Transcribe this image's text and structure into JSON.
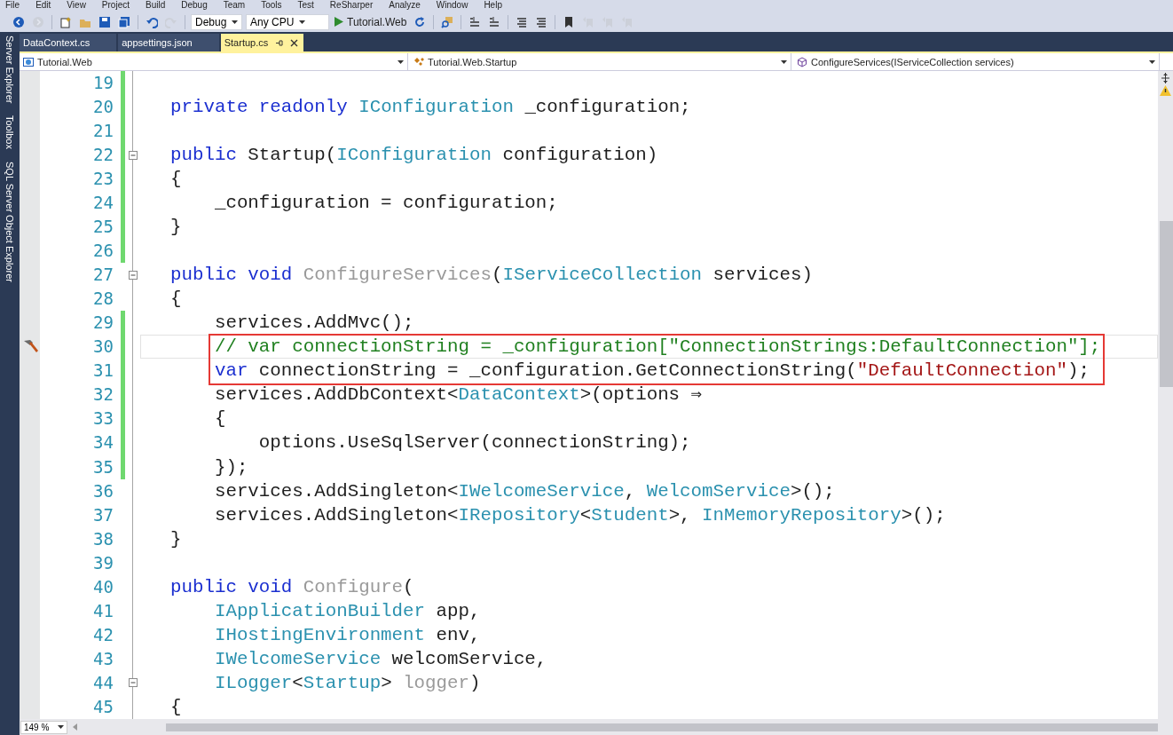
{
  "menu": [
    "File",
    "Edit",
    "View",
    "Project",
    "Build",
    "Debug",
    "Team",
    "Tools",
    "Test",
    "ReSharper",
    "Analyze",
    "Window",
    "Help"
  ],
  "toolbar": [
    {
      "kind": "back",
      "disabled": false
    },
    {
      "kind": "forward",
      "disabled": true
    },
    {
      "kind": "sep"
    },
    {
      "kind": "new-project",
      "disabled": false
    },
    {
      "kind": "open",
      "disabled": false
    },
    {
      "kind": "save",
      "disabled": false
    },
    {
      "kind": "save-all",
      "disabled": false
    },
    {
      "kind": "sep"
    },
    {
      "kind": "undo",
      "disabled": false
    },
    {
      "kind": "redo",
      "disabled": true
    },
    {
      "kind": "sep"
    },
    {
      "kind": "combo",
      "value": "Debug"
    },
    {
      "kind": "combo",
      "value": "Any CPU"
    },
    {
      "kind": "start",
      "label": "Tutorial.Web"
    },
    {
      "kind": "refresh",
      "disabled": false
    },
    {
      "kind": "sep"
    },
    {
      "kind": "find",
      "disabled": false
    },
    {
      "kind": "sep"
    },
    {
      "kind": "step",
      "disabled": false
    },
    {
      "kind": "step",
      "disabled": false
    },
    {
      "kind": "sep"
    },
    {
      "kind": "comment",
      "disabled": false
    },
    {
      "kind": "comment",
      "disabled": false
    },
    {
      "kind": "sep"
    },
    {
      "kind": "bookmark",
      "disabled": false
    },
    {
      "kind": "bookmark-nav",
      "disabled": true
    },
    {
      "kind": "bookmark-nav",
      "disabled": true
    },
    {
      "kind": "bookmark-nav",
      "disabled": true
    }
  ],
  "side_panels": [
    "Server Explorer",
    "Toolbox",
    "SQL Server Object Explorer"
  ],
  "tabs": [
    {
      "label": "DataContext.cs",
      "selected": false
    },
    {
      "label": "appsettings.json",
      "selected": false
    },
    {
      "label": "Startup.cs",
      "selected": true
    }
  ],
  "navigation": [
    {
      "kind": "project",
      "label": "Tutorial.Web"
    },
    {
      "kind": "class",
      "label": "Tutorial.Web.Startup"
    },
    {
      "kind": "method",
      "label": "ConfigureServices(IServiceCollection services)"
    }
  ],
  "code": {
    "lines": [
      {
        "number": "19",
        "changed": true,
        "foldable": false,
        "current": false,
        "boxed": false
      },
      {
        "number": "20",
        "changed": true,
        "foldable": false,
        "current": false,
        "boxed": false,
        "tokens": [
          {
            "text": "private",
            "kind": "keyword"
          },
          {
            "text": " readonly",
            "kind": "keyword"
          },
          {
            "text": " IConfiguration",
            "kind": "type"
          },
          {
            "text": " _configuration;",
            "kind": "plain"
          }
        ]
      },
      {
        "number": "21",
        "changed": true,
        "foldable": false,
        "current": false,
        "boxed": false
      },
      {
        "number": "22",
        "changed": true,
        "foldable": true,
        "current": false,
        "boxed": false,
        "tokens": [
          {
            "text": "public",
            "kind": "keyword"
          },
          {
            "text": " Startup(",
            "kind": "plain"
          },
          {
            "text": "IConfiguration",
            "kind": "type"
          },
          {
            "text": " configuration)",
            "kind": "plain"
          }
        ]
      },
      {
        "number": "23",
        "changed": true,
        "foldable": false,
        "current": false,
        "boxed": false,
        "tokens": [
          {
            "text": "{",
            "kind": "plain"
          }
        ]
      },
      {
        "number": "24",
        "changed": true,
        "foldable": false,
        "current": false,
        "boxed": false,
        "tokens": [
          {
            "text": "    _configuration = configuration;",
            "kind": "plain"
          }
        ]
      },
      {
        "number": "25",
        "changed": true,
        "foldable": false,
        "current": false,
        "boxed": false,
        "tokens": [
          {
            "text": "}",
            "kind": "plain"
          }
        ]
      },
      {
        "number": "26",
        "changed": true,
        "foldable": false,
        "current": false,
        "boxed": false
      },
      {
        "number": "27",
        "changed": false,
        "foldable": true,
        "current": false,
        "boxed": false,
        "tokens": [
          {
            "text": "public",
            "kind": "keyword"
          },
          {
            "text": " void",
            "kind": "keyword"
          },
          {
            "text": " ConfigureServices",
            "kind": "dim"
          },
          {
            "text": "(",
            "kind": "plain"
          },
          {
            "text": "IServiceCollection",
            "kind": "type"
          },
          {
            "text": " services)",
            "kind": "plain"
          }
        ]
      },
      {
        "number": "28",
        "changed": false,
        "foldable": false,
        "current": false,
        "boxed": false,
        "tokens": [
          {
            "text": "{",
            "kind": "plain"
          }
        ]
      },
      {
        "number": "29",
        "changed": true,
        "foldable": false,
        "current": false,
        "boxed": false,
        "tokens": [
          {
            "text": "    services.AddMvc();",
            "kind": "plain"
          }
        ]
      },
      {
        "number": "30",
        "changed": true,
        "foldable": false,
        "current": true,
        "boxed": true,
        "action_glyph": true,
        "tokens": [
          {
            "text": "    // var connectionString = _configuration[\"ConnectionStrings:DefaultConnection\"];",
            "kind": "comment"
          }
        ]
      },
      {
        "number": "31",
        "changed": true,
        "foldable": false,
        "current": false,
        "boxed": true,
        "tokens": [
          {
            "text": "    var",
            "kind": "keyword"
          },
          {
            "text": " connectionString = _configuration.GetConnectionString(",
            "kind": "plain"
          },
          {
            "text": "\"DefaultConnection\"",
            "kind": "string"
          },
          {
            "text": ");",
            "kind": "plain"
          }
        ]
      },
      {
        "number": "32",
        "changed": true,
        "foldable": false,
        "current": false,
        "boxed": false,
        "tokens": [
          {
            "text": "    services.AddDbContext<",
            "kind": "plain"
          },
          {
            "text": "DataContext",
            "kind": "type"
          },
          {
            "text": ">(options ⇒",
            "kind": "plain"
          }
        ]
      },
      {
        "number": "33",
        "changed": true,
        "foldable": false,
        "current": false,
        "boxed": false,
        "tokens": [
          {
            "text": "    {",
            "kind": "plain"
          }
        ]
      },
      {
        "number": "34",
        "changed": true,
        "foldable": false,
        "current": false,
        "boxed": false,
        "tokens": [
          {
            "text": "        options.UseSqlServer(connectionString);",
            "kind": "plain"
          }
        ]
      },
      {
        "number": "35",
        "changed": true,
        "foldable": false,
        "current": false,
        "boxed": false,
        "tokens": [
          {
            "text": "    });",
            "kind": "plain"
          }
        ]
      },
      {
        "number": "36",
        "changed": false,
        "foldable": false,
        "current": false,
        "boxed": false,
        "tokens": [
          {
            "text": "    services.AddSingleton<",
            "kind": "plain"
          },
          {
            "text": "IWelcomeService",
            "kind": "type"
          },
          {
            "text": ", ",
            "kind": "plain"
          },
          {
            "text": "WelcomService",
            "kind": "type"
          },
          {
            "text": ">();",
            "kind": "plain"
          }
        ]
      },
      {
        "number": "37",
        "changed": false,
        "foldable": false,
        "current": false,
        "boxed": false,
        "tokens": [
          {
            "text": "    services.AddSingleton<",
            "kind": "plain"
          },
          {
            "text": "IRepository",
            "kind": "type"
          },
          {
            "text": "<",
            "kind": "plain"
          },
          {
            "text": "Student",
            "kind": "type"
          },
          {
            "text": ">, ",
            "kind": "plain"
          },
          {
            "text": "InMemoryRepository",
            "kind": "type"
          },
          {
            "text": ">();",
            "kind": "plain"
          }
        ]
      },
      {
        "number": "38",
        "changed": false,
        "foldable": false,
        "current": false,
        "boxed": false,
        "tokens": [
          {
            "text": "}",
            "kind": "plain"
          }
        ]
      },
      {
        "number": "39",
        "changed": false,
        "foldable": false,
        "current": false,
        "boxed": false
      },
      {
        "number": "40",
        "changed": false,
        "foldable": false,
        "current": false,
        "boxed": false,
        "tokens": [
          {
            "text": "public",
            "kind": "keyword"
          },
          {
            "text": " void",
            "kind": "keyword"
          },
          {
            "text": " Configure",
            "kind": "dim"
          },
          {
            "text": "(",
            "kind": "plain"
          }
        ]
      },
      {
        "number": "41",
        "changed": false,
        "foldable": false,
        "current": false,
        "boxed": false,
        "tokens": [
          {
            "text": "    IApplicationBuilder",
            "kind": "type"
          },
          {
            "text": " app,",
            "kind": "plain"
          }
        ]
      },
      {
        "number": "42",
        "changed": false,
        "foldable": false,
        "current": false,
        "boxed": false,
        "tokens": [
          {
            "text": "    IHostingEnvironment",
            "kind": "type"
          },
          {
            "text": " env,",
            "kind": "plain"
          }
        ]
      },
      {
        "number": "43",
        "changed": false,
        "foldable": false,
        "current": false,
        "boxed": false,
        "tokens": [
          {
            "text": "    IWelcomeService",
            "kind": "type"
          },
          {
            "text": " welcomService,",
            "kind": "plain"
          }
        ]
      },
      {
        "number": "44",
        "changed": false,
        "foldable": true,
        "current": false,
        "boxed": false,
        "tokens": [
          {
            "text": "    ILogger",
            "kind": "type"
          },
          {
            "text": "<",
            "kind": "plain"
          },
          {
            "text": "Startup",
            "kind": "type"
          },
          {
            "text": "> ",
            "kind": "plain"
          },
          {
            "text": "logger",
            "kind": "dim"
          },
          {
            "text": ")",
            "kind": "plain"
          }
        ]
      },
      {
        "number": "45",
        "changed": false,
        "foldable": false,
        "current": false,
        "boxed": false,
        "tokens": [
          {
            "text": "{",
            "kind": "plain"
          }
        ]
      }
    ]
  },
  "zoom": "149 %"
}
